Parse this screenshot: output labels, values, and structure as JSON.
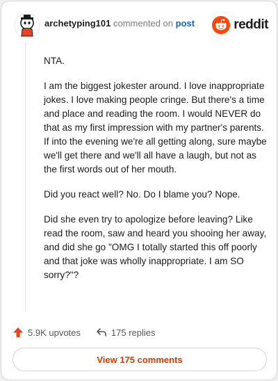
{
  "header": {
    "username": "archetyping101",
    "commented_text": "commented on",
    "post_link": "post",
    "logo_text": "reddit"
  },
  "comment": {
    "paragraphs": [
      "NTA.",
      "I am the biggest jokester around. I love inappropriate jokes. I love making people cringe. But there's a time and place and reading the room. I would NEVER do that as my first impression with my partner's parents. If into the evening we're all getting along, sure maybe we'll get there and we'll all have a laugh, but not as the first words out of her mouth.",
      "Did you react well? No. Do I blame you? Nope.",
      "Did she even try to apologize before leaving? Like read the room, saw and heard you shooing her away, and did she go \"OMG I totally started this off poorly and that joke was wholly inappropriate. I am SO sorry?\"?"
    ]
  },
  "actions": {
    "upvotes": "5.9K upvotes",
    "replies": "175 replies"
  },
  "view_comments_label": "View 175 comments",
  "colors": {
    "reddit_orange": "#ff4500",
    "upvote": "#e8431f",
    "link_blue": "#0a66c2",
    "button_text": "#d93a00"
  }
}
